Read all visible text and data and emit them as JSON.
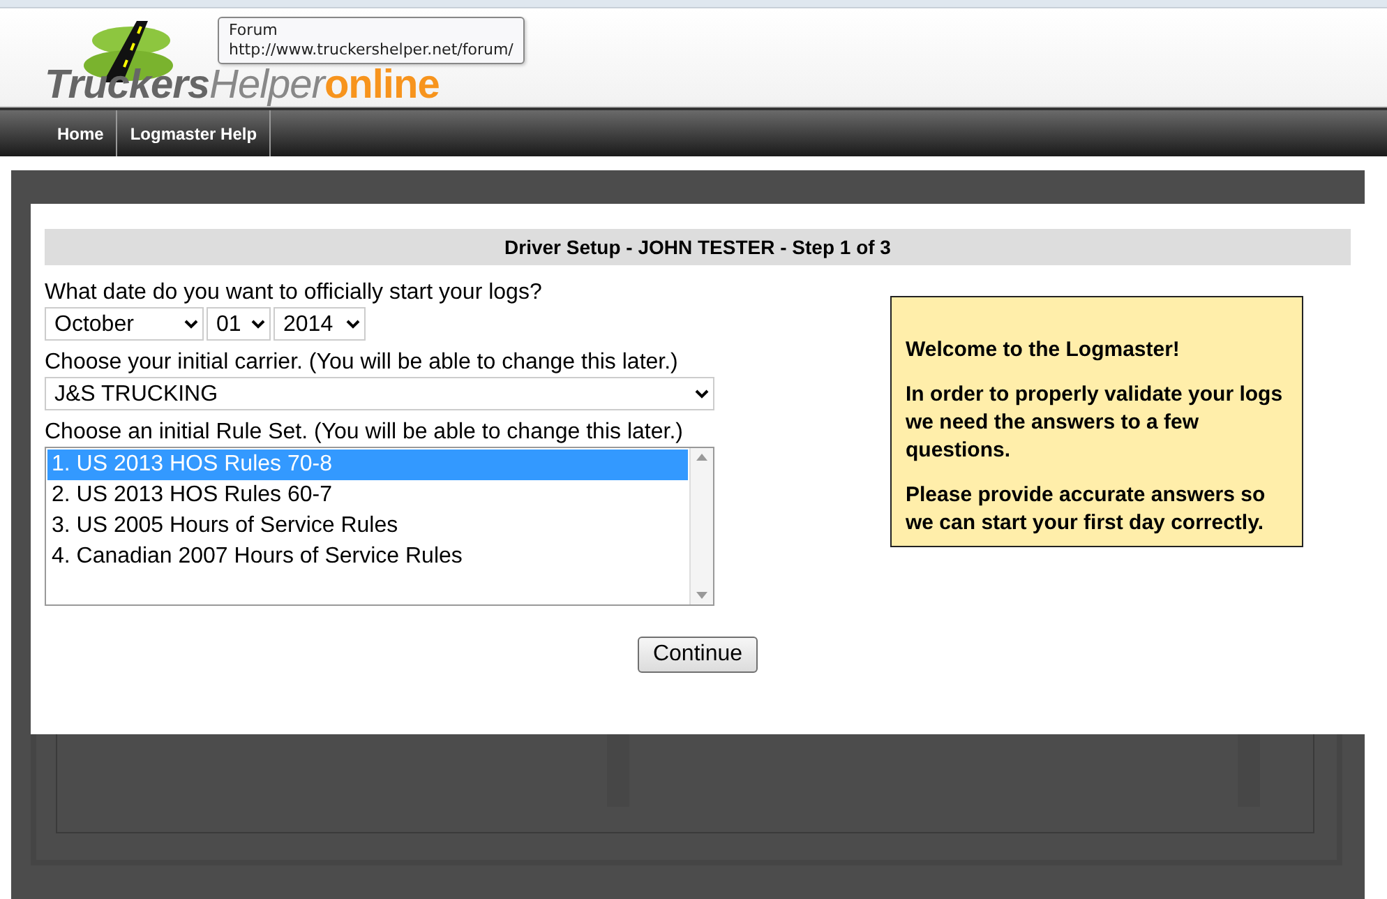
{
  "logo": {
    "part_1": "Truckers",
    "part_2": "Helper",
    "part_3": "online"
  },
  "tooltip": {
    "title": "Forum",
    "url": "http://www.truckershelper.net/forum/"
  },
  "nav": [
    {
      "label": "Home"
    },
    {
      "label": "Logmaster Help"
    }
  ],
  "dialog": {
    "title": "Driver Setup - JOHN TESTER - Step 1 of 3",
    "date_label": "What date do you want to officially start your logs?",
    "date": {
      "month": "October",
      "day": "01",
      "year": "2014"
    },
    "carrier_label": "Choose your initial carrier. (You will be able to change this later.)",
    "carrier": "J&S TRUCKING",
    "rules_label": "Choose an initial Rule Set. (You will be able to change this later.)",
    "rules": [
      {
        "label": "1. US 2013 HOS Rules 70-8",
        "selected": true
      },
      {
        "label": "2. US 2013 HOS Rules 60-7",
        "selected": false
      },
      {
        "label": "3. US 2005 Hours of Service Rules",
        "selected": false
      },
      {
        "label": "4. Canadian 2007 Hours of Service Rules",
        "selected": false
      }
    ],
    "info": [
      "Welcome to the Logmaster!",
      "In order to properly validate your logs we need the answers to a few questions.",
      "Please provide accurate answers so we can start your first day correctly."
    ],
    "continue_button": "Continue"
  }
}
